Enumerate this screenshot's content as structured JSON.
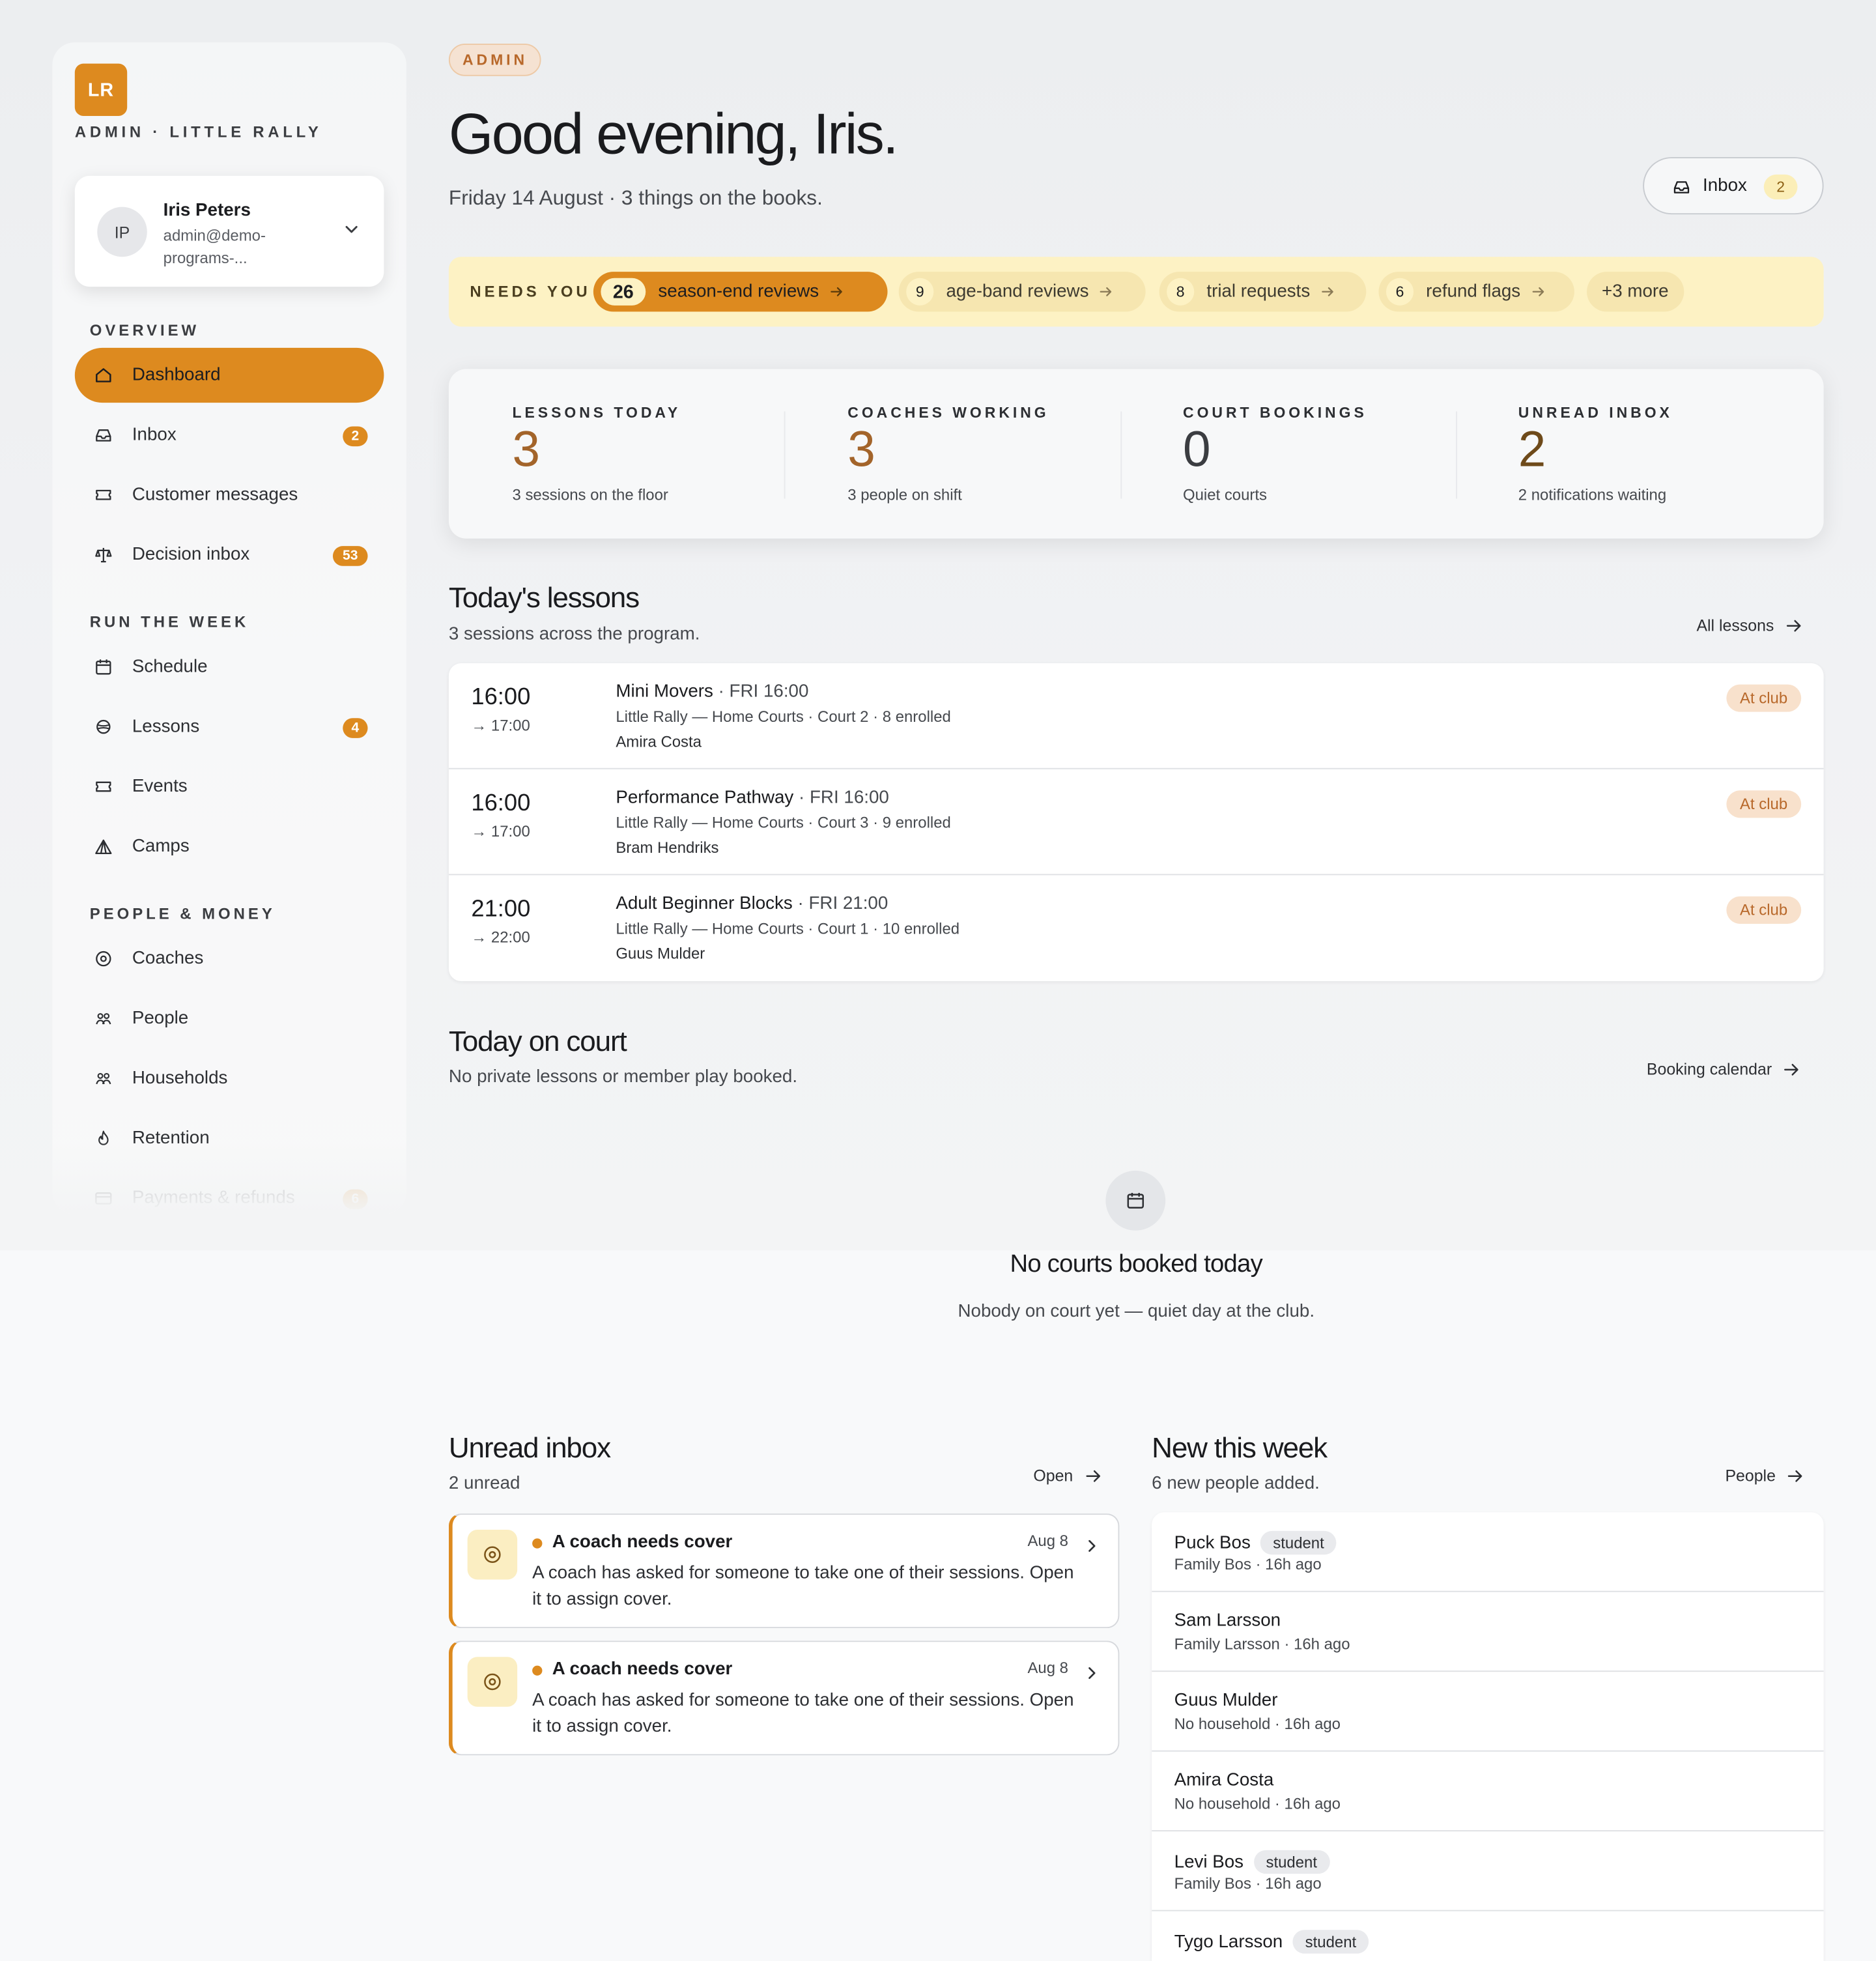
{
  "brand": {
    "logo": "LR",
    "text": "ADMIN · LITTLE RALLY"
  },
  "user": {
    "initials": "IP",
    "name": "Iris Peters",
    "email": "admin@demo-programs-..."
  },
  "nav": {
    "overview": {
      "heading": "OVERVIEW",
      "items": [
        {
          "label": "Dashboard",
          "icon": "home-icon",
          "active": true,
          "badge": ""
        },
        {
          "label": "Inbox",
          "icon": "inbox-icon",
          "badge": "2"
        },
        {
          "label": "Customer messages",
          "icon": "ticket-icon",
          "badge": ""
        },
        {
          "label": "Decision inbox",
          "icon": "scale-icon",
          "badge": "53"
        }
      ]
    },
    "run": {
      "heading": "RUN THE WEEK",
      "items": [
        {
          "label": "Schedule",
          "icon": "calendar-icon",
          "badge": ""
        },
        {
          "label": "Lessons",
          "icon": "ball-icon",
          "badge": "4"
        },
        {
          "label": "Events",
          "icon": "ticket-icon",
          "badge": ""
        },
        {
          "label": "Camps",
          "icon": "tent-icon",
          "badge": ""
        }
      ]
    },
    "people": {
      "heading": "PEOPLE & MONEY",
      "items": [
        {
          "label": "Coaches",
          "icon": "target-icon",
          "badge": ""
        },
        {
          "label": "People",
          "icon": "users-icon",
          "badge": ""
        },
        {
          "label": "Households",
          "icon": "users-icon",
          "badge": ""
        },
        {
          "label": "Retention",
          "icon": "flame-icon",
          "badge": ""
        },
        {
          "label": "Payments & refunds",
          "icon": "card-icon",
          "badge": "6"
        }
      ]
    }
  },
  "header": {
    "pill": "ADMIN",
    "greeting": "Good evening, Iris.",
    "subtitle": "Friday 14 August · 3 things on the books.",
    "inbox_label": "Inbox",
    "inbox_count": "2"
  },
  "needs": {
    "label": "NEEDS YOU",
    "chips": [
      {
        "count": "26",
        "label": "season-end reviews"
      },
      {
        "count": "9",
        "label": "age-band reviews"
      },
      {
        "count": "8",
        "label": "trial requests"
      },
      {
        "count": "6",
        "label": "refund flags"
      }
    ],
    "more": "+3 more"
  },
  "stats": [
    {
      "label": "LESSONS TODAY",
      "value": "3",
      "sub": "3 sessions on the floor",
      "color": "#a3642a"
    },
    {
      "label": "COACHES WORKING",
      "value": "3",
      "sub": "3 people on shift",
      "color": "#a3642a"
    },
    {
      "label": "COURT BOOKINGS",
      "value": "0",
      "sub": "Quiet courts",
      "color": "#3b3d41"
    },
    {
      "label": "UNREAD INBOX",
      "value": "2",
      "sub": "2 notifications waiting",
      "color": "#6e4a1a"
    }
  ],
  "lessons": {
    "title": "Today's lessons",
    "subtitle": "3 sessions across the program.",
    "link": "All lessons",
    "rows": [
      {
        "start": "16:00",
        "end": "→ 17:00",
        "name": "Mini Movers",
        "when": " · FRI 16:00",
        "meta": "Little Rally — Home Courts · Court 2 · 8 enrolled",
        "coach": "Amira Costa",
        "badge": "At club"
      },
      {
        "start": "16:00",
        "end": "→ 17:00",
        "name": "Performance Pathway",
        "when": " · FRI 16:00",
        "meta": "Little Rally — Home Courts · Court 3 · 9 enrolled",
        "coach": "Bram Hendriks",
        "badge": "At club"
      },
      {
        "start": "21:00",
        "end": "→ 22:00",
        "name": "Adult Beginner Blocks",
        "when": " · FRI 21:00",
        "meta": "Little Rally — Home Courts · Court 1 · 10 enrolled",
        "coach": "Guus Mulder",
        "badge": "At club"
      }
    ]
  },
  "court": {
    "title": "Today on court",
    "subtitle": "No private lessons or member play booked.",
    "link": "Booking calendar",
    "empty_title": "No courts booked today",
    "empty_sub": "Nobody on court yet — quiet day at the club."
  },
  "inbox": {
    "title": "Unread inbox",
    "subtitle": "2 unread",
    "link": "Open",
    "messages": [
      {
        "title": "A coach needs cover",
        "date": "Aug 8",
        "body": "A coach has asked for someone to take one of their sessions. Open it to assign cover."
      },
      {
        "title": "A coach needs cover",
        "date": "Aug 8",
        "body": "A coach has asked for someone to take one of their sessions. Open it to assign cover."
      }
    ]
  },
  "newweek": {
    "title": "New this week",
    "subtitle": "6 new people added.",
    "link": "People",
    "people": [
      {
        "name": "Puck Bos",
        "tag": "student",
        "sub": "Family Bos · 16h ago"
      },
      {
        "name": "Sam Larsson",
        "tag": "",
        "sub": "Family Larsson · 16h ago"
      },
      {
        "name": "Guus Mulder",
        "tag": "",
        "sub": "No household · 16h ago"
      },
      {
        "name": "Amira Costa",
        "tag": "",
        "sub": "No household · 16h ago"
      },
      {
        "name": "Levi Bos",
        "tag": "student",
        "sub": "Family Bos · 16h ago"
      },
      {
        "name": "Tygo Larsson",
        "tag": "student",
        "sub": ""
      }
    ]
  },
  "colors": {
    "accent": "#dd8a1f",
    "needs_bg": "#fdf2c4",
    "badge_bg": "#f8e1cc",
    "badge_text": "#b8682a"
  }
}
